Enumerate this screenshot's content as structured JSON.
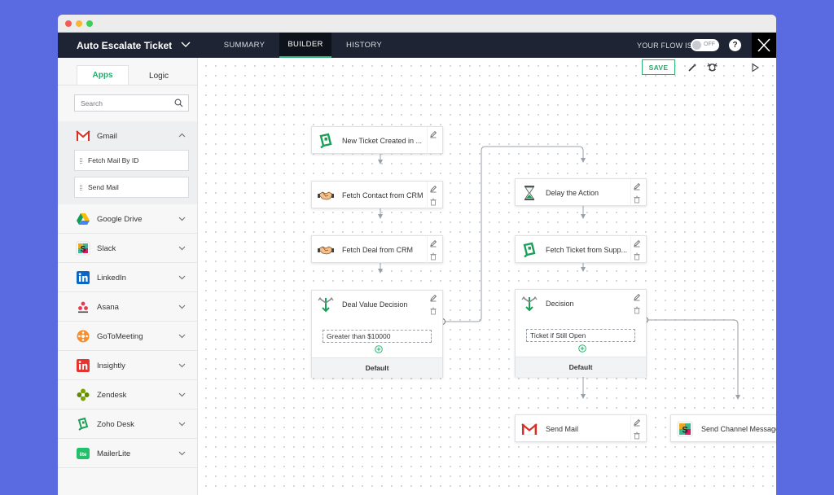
{
  "window": {
    "dots": [
      "#f25c54",
      "#f7b733",
      "#3ecf5a"
    ]
  },
  "topbar": {
    "flow_name": "Auto Escalate Ticket",
    "tabs": [
      {
        "label": "SUMMARY",
        "active": false
      },
      {
        "label": "BUILDER",
        "active": true
      },
      {
        "label": "HISTORY",
        "active": false
      }
    ],
    "toggle_label": "YOUR FLOW IS",
    "toggle_state": "OFF",
    "help": "?"
  },
  "sidebar": {
    "tabs": [
      {
        "label": "Apps",
        "active": true
      },
      {
        "label": "Logic",
        "active": false
      }
    ],
    "search_placeholder": "Search",
    "gmail": {
      "label": "Gmail",
      "icon": "gmail-icon",
      "actions": [
        "Fetch Mail By ID",
        "Send Mail"
      ]
    },
    "apps": [
      {
        "label": "Google Drive",
        "icon": "google-drive-icon"
      },
      {
        "label": "Slack",
        "icon": "slack-icon"
      },
      {
        "label": "LinkedIn",
        "icon": "linkedin-icon"
      },
      {
        "label": "Asana",
        "icon": "asana-icon"
      },
      {
        "label": "GoToMeeting",
        "icon": "gotomeeting-icon"
      },
      {
        "label": "Insightly",
        "icon": "insightly-icon"
      },
      {
        "label": "Zendesk",
        "icon": "zendesk-icon"
      },
      {
        "label": "Zoho Desk",
        "icon": "zoho-desk-icon"
      },
      {
        "label": "MailerLite",
        "icon": "mailerlite-icon"
      }
    ]
  },
  "canvas": {
    "save_label": "SAVE",
    "tools": [
      "magic-wand-icon",
      "undo-icon",
      "redo-icon",
      "play-icon"
    ],
    "nodes": {
      "new_ticket": "New Ticket Created in ...",
      "fetch_contact": "Fetch Contact from CRM",
      "fetch_deal": "Fetch Deal from CRM",
      "delay": "Delay the Action",
      "fetch_ticket": "Fetch Ticket from Supp...",
      "send_mail": "Send Mail",
      "send_channel": "Send Channel Message"
    },
    "deal_decision": {
      "title": "Deal Value Decision",
      "condition": "Greater than $10000",
      "default": "Default"
    },
    "decision": {
      "title": "Decision",
      "condition": "Ticket if Still Open",
      "default": "Default"
    }
  },
  "colors": {
    "accent": "#2bb573",
    "topbar": "#1e2433",
    "background": "#5a6ae0"
  }
}
